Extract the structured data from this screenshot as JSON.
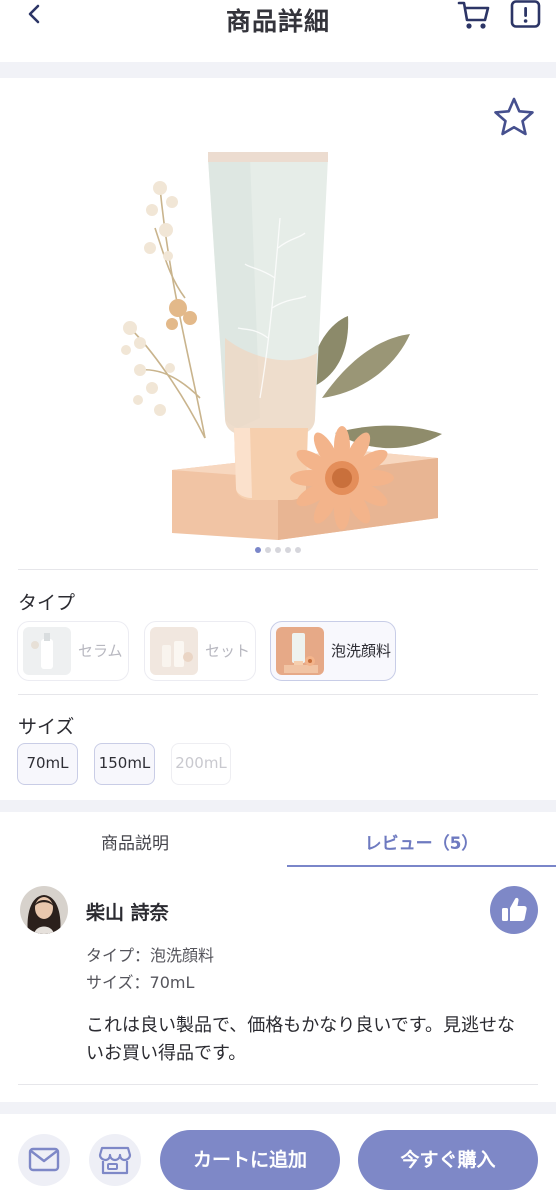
{
  "header": {
    "title": "商品詳細",
    "back_icon": "chevron-left-icon",
    "cart_icon": "cart-icon",
    "report_icon": "alert-icon"
  },
  "product": {
    "favorite_icon": "star-outline-icon",
    "image_count": 5,
    "active_image": 1
  },
  "type_selector": {
    "label": "タイプ",
    "options": [
      {
        "label": "セラム",
        "selected": false
      },
      {
        "label": "セット",
        "selected": false
      },
      {
        "label": "泡洗顔料",
        "selected": true
      }
    ]
  },
  "size_selector": {
    "label": "サイズ",
    "options": [
      {
        "label": "70mL",
        "enabled": true
      },
      {
        "label": "150mL",
        "enabled": true
      },
      {
        "label": "200mL",
        "enabled": false
      }
    ]
  },
  "tabs": [
    {
      "label": "商品説明",
      "active": false
    },
    {
      "label": "レビュー（5）",
      "active": true
    }
  ],
  "review": {
    "reviewer_name": "柴山 詩奈",
    "type_line": "タイプ：泡洗顔料",
    "size_line": "サイズ：70mL",
    "body": "これは良い製品で、価格もかなり良いです。見逃せないお買い得品です。",
    "like_icon": "thumbs-up-icon"
  },
  "bottom_bar": {
    "mail_icon": "mail-icon",
    "store_icon": "store-icon",
    "add_to_cart_label": "カートに追加",
    "buy_now_label": "今すぐ購入"
  },
  "colors": {
    "accent": "#7e88c7",
    "accent_text": "#6e7ac0",
    "background": "#f1f2f7"
  }
}
